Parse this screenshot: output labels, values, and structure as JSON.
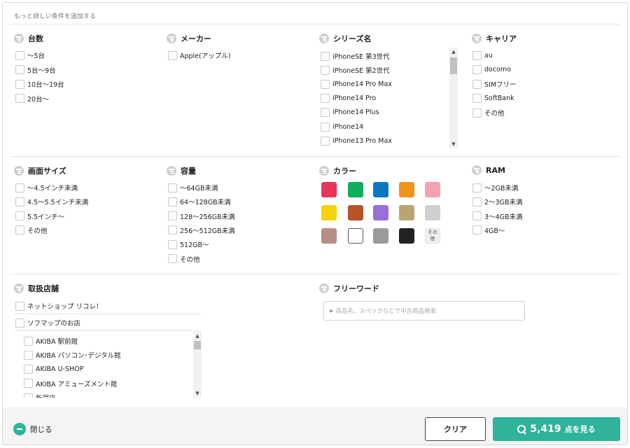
{
  "header": {
    "title": "もっと詳しい条件を追加する"
  },
  "count_section": {
    "title": "台数",
    "options": [
      "〜5台",
      "5台〜9台",
      "10台〜19台",
      "20台〜"
    ]
  },
  "maker_section": {
    "title": "メーカー",
    "options": [
      "Apple(アップル)"
    ]
  },
  "series_section": {
    "title": "シリーズ名",
    "options": [
      "iPhoneSE 第3世代",
      "iPhoneSE 第2世代",
      "iPhone14 Pro Max",
      "iPhone14 Pro",
      "iPhone14 Plus",
      "iPhone14",
      "iPhone13 Pro Max"
    ],
    "scroll_up": "▲",
    "scroll_down": "▼"
  },
  "carrier_section": {
    "title": "キャリア",
    "options": [
      "au",
      "docomo",
      "SIMフリー",
      "SoftBank",
      "その他"
    ]
  },
  "screen_section": {
    "title": "画面サイズ",
    "options": [
      "〜4.5インチ未満",
      "4.5〜5.5インチ未満",
      "5.5インチ〜",
      "その他"
    ]
  },
  "capacity_section": {
    "title": "容量",
    "options": [
      "〜64GB未満",
      "64〜128GB未満",
      "128〜256GB未満",
      "256〜512GB未満",
      "512GB〜",
      "その他"
    ]
  },
  "color_section": {
    "title": "カラー",
    "swatches": [
      {
        "name": "red",
        "color": "#e8365a"
      },
      {
        "name": "green",
        "color": "#0fae5c"
      },
      {
        "name": "blue",
        "color": "#0d76c0"
      },
      {
        "name": "orange",
        "color": "#f0941a"
      },
      {
        "name": "pink",
        "color": "#f3a3ad"
      },
      {
        "name": "yellow",
        "color": "#f5d20b"
      },
      {
        "name": "brown",
        "color": "#b4532a"
      },
      {
        "name": "purple",
        "color": "#9b6fd9"
      },
      {
        "name": "gold",
        "color": "#b9a571"
      },
      {
        "name": "silver",
        "color": "#cfcfcf"
      },
      {
        "name": "rose-gold",
        "color": "#b88d84"
      },
      {
        "name": "white",
        "color": "#ffffff"
      },
      {
        "name": "gray",
        "color": "#9a9a9a"
      },
      {
        "name": "black",
        "color": "#222222"
      }
    ],
    "other_label": "その他"
  },
  "ram_section": {
    "title": "RAM",
    "options": [
      "〜2GB未満",
      "2〜3GB未満",
      "3〜4GB未満",
      "4GB〜"
    ]
  },
  "store_section": {
    "title": "取扱店舗",
    "top_options": [
      "ネットショップ リコレ！",
      "ソフマップのお店"
    ],
    "stores": [
      "AKIBA 駅前館",
      "AKIBA パソコン･デジタル館",
      "AKIBA U-SHOP",
      "AKIBA アミューズメント館",
      "新宿店"
    ],
    "scroll_up": "▲",
    "scroll_down": "▼"
  },
  "freeword_section": {
    "title": "フリーワード",
    "placeholder": "商品名、スペックなどで中古商品検索",
    "caret": "▶"
  },
  "footer": {
    "close_label": "閉じる",
    "clear_label": "クリア",
    "result_count": "5,419",
    "result_suffix": "点を見る"
  },
  "colors": {
    "accent": "#2fb39a"
  }
}
